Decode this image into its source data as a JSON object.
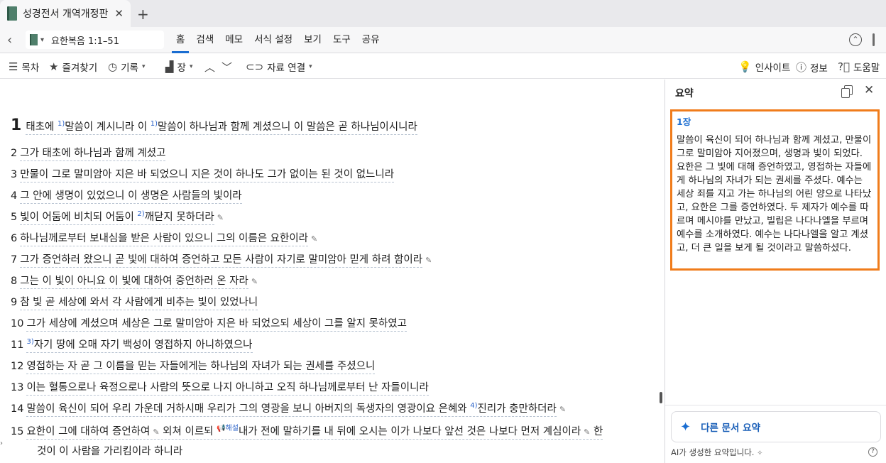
{
  "tab": {
    "title": "성경전서 개역개정판",
    "close": "✕",
    "new": "+"
  },
  "nav": {
    "back": "‹",
    "passage": "요한복음 1:1–51",
    "menu": [
      "홈",
      "검색",
      "메모",
      "서식 설정",
      "보기",
      "도구",
      "공유"
    ],
    "active_index": 0
  },
  "toolbar": {
    "toc": "목차",
    "favorites": "즐겨찾기",
    "history": "기록",
    "chapter": "장",
    "link": "자료 연결",
    "insight": "인사이트",
    "info": "정보",
    "help": "도움말"
  },
  "verses": [
    {
      "num": "1",
      "parts": [
        {
          "t": "태초에 "
        },
        {
          "fn": "1)"
        },
        {
          "t": "말씀이 계시니라 이 "
        },
        {
          "fn": "1)"
        },
        {
          "t": "말씀이 하나님과 함께 계셨으니 이 말씀은 곧 하나님이시니라"
        }
      ],
      "pen": false
    },
    {
      "num": "2",
      "parts": [
        {
          "t": "그가 태초에 하나님과 함께 계셨고"
        }
      ],
      "pen": false
    },
    {
      "num": "3",
      "parts": [
        {
          "t": "만물이 그로 말미암아 지은 바 되었으니 지은 것이 하나도 그가 없이는 된 것이 없느니라"
        }
      ],
      "pen": false
    },
    {
      "num": "4",
      "parts": [
        {
          "t": "그 안에 생명이 있었으니 이 생명은 사람들의 빛이라"
        }
      ],
      "pen": false
    },
    {
      "num": "5",
      "parts": [
        {
          "t": "빛이 어둠에 비치되 어둠이 "
        },
        {
          "fn": "2)"
        },
        {
          "t": "깨닫지 못하더라"
        }
      ],
      "pen": true
    },
    {
      "num": "6",
      "parts": [
        {
          "t": "하나님께로부터 보내심을 받은 사람이 있으니 그의 이름은 요한이라"
        }
      ],
      "pen": true
    },
    {
      "num": "7",
      "parts": [
        {
          "t": "그가 증언하러 왔으니 곧 빛에 대하여 증언하고 모든 사람이 자기로 말미암아 믿게 하려 함이라"
        }
      ],
      "pen": true
    },
    {
      "num": "8",
      "parts": [
        {
          "t": "그는 이 빛이 아니요 이 빛에 대하여 증언하러 온 자라"
        }
      ],
      "pen": true
    },
    {
      "num": "9",
      "parts": [
        {
          "t": "참 빛 곧 세상에 와서 각 사람에게 비추는 빛이 있었나니"
        }
      ],
      "pen": false
    },
    {
      "num": "10",
      "parts": [
        {
          "t": "그가 세상에 계셨으며 세상은 그로 말미암아 지은 바 되었으되 세상이 그를 알지 못하였고"
        }
      ],
      "pen": false
    },
    {
      "num": "11",
      "parts": [
        {
          "fn": "3)"
        },
        {
          "t": "자기 땅에 오매 자기 백성이 영접하지 아니하였으나"
        }
      ],
      "pen": false
    },
    {
      "num": "12",
      "parts": [
        {
          "t": "영접하는 자 곧 그 이름을 믿는 자들에게는 하나님의 자녀가 되는 권세를 주셨으니"
        }
      ],
      "pen": false
    },
    {
      "num": "13",
      "parts": [
        {
          "t": "이는 혈통으로나 육정으로나 사람의 뜻으로 나지 아니하고 오직 하나님께로부터 난 자들이니라"
        }
      ],
      "pen": false
    },
    {
      "num": "14",
      "parts": [
        {
          "t": "말씀이 육신이 되어 우리 가운데 거하시매 우리가 그의 영광을 보니 아버지의 독생자의 영광이요 은혜와 "
        },
        {
          "fn": "4)"
        },
        {
          "t": "진리가 충만하더라"
        }
      ],
      "pen": true
    },
    {
      "num": "15",
      "parts": [
        {
          "t": "요한이 그에 대하여 증언하여"
        },
        {
          "pen": "✎"
        },
        {
          "t": " 외쳐 이르되 "
        },
        {
          "fn": "📢해설"
        },
        {
          "t": "내가 전에 말하기를 내 뒤에 오시는 이가 나보다 앞선 것은 나보다 먼저 계심이라"
        },
        {
          "pen": "✎"
        },
        {
          "t": " 한"
        }
      ],
      "pen": false,
      "cont": "것이 이 사람을 가리킴이라 하니라"
    }
  ],
  "panel": {
    "title": "요약",
    "chapter": "1장",
    "summary": "말씀이 육신이 되어 하나님과 함께 계셨고, 만물이 그로 말미암아 지어졌으며, 생명과 빛이 되었다. 요한은 그 빛에 대해 증언하였고, 영접하는 자들에게 하나님의 자녀가 되는 권세를 주셨다. 예수는 세상 죄를 지고 가는 하나님의 어린 양으로 나타났고, 요한은 그를 증언하였다. 두 제자가 예수를 따르며 메시야를 만났고, 빌립은 나다나엘을 부르며 예수를 소개하였다. 예수는 나다나엘을 알고 계셨고, 더 큰 일을 보게 될 것이라고 말씀하셨다.",
    "other_button": "다른 문서 요약",
    "ai_note": "AI가 생성한 요약입니다."
  },
  "colors": {
    "accent": "#1a6dd1",
    "highlight_border": "#f07c1b",
    "footnote": "#2a62c9"
  }
}
